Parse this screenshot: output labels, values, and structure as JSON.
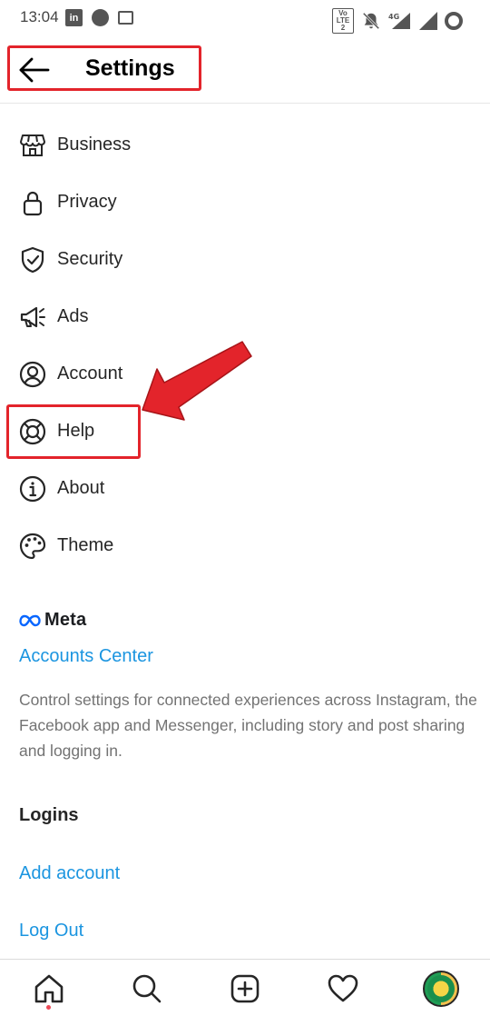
{
  "status_bar": {
    "time": "13:04",
    "left_icons": [
      "linkedin-icon",
      "circle-notification-icon",
      "image-icon"
    ],
    "right_icons": [
      "volte-icon",
      "bell-muted-icon",
      "4g-signal-icon",
      "signal-icon",
      "battery-icon"
    ],
    "volte_text": "Vo LTE 2",
    "linkedin_text": "in"
  },
  "header": {
    "title": "Settings"
  },
  "menu": {
    "items": [
      {
        "label": "Business",
        "icon": "store-icon"
      },
      {
        "label": "Privacy",
        "icon": "lock-icon"
      },
      {
        "label": "Security",
        "icon": "shield-icon"
      },
      {
        "label": "Ads",
        "icon": "megaphone-icon"
      },
      {
        "label": "Account",
        "icon": "user-circle-icon"
      },
      {
        "label": "Help",
        "icon": "lifebuoy-icon"
      },
      {
        "label": "About",
        "icon": "info-icon"
      },
      {
        "label": "Theme",
        "icon": "palette-icon"
      }
    ]
  },
  "meta": {
    "logo_text": "Meta",
    "accounts_center": "Accounts Center",
    "description": "Control settings for connected experiences across Instagram, the Facebook app and Messenger, including story and post sharing and logging in."
  },
  "logins": {
    "title": "Logins",
    "add_account": "Add account",
    "log_out": "Log Out"
  },
  "bottom_nav": {
    "items": [
      "home-icon",
      "search-icon",
      "create-icon",
      "heart-icon",
      "profile-avatar"
    ]
  },
  "colors": {
    "link": "#1b95e0",
    "highlight": "#e3242b",
    "text": "#262626",
    "muted": "#737373"
  }
}
